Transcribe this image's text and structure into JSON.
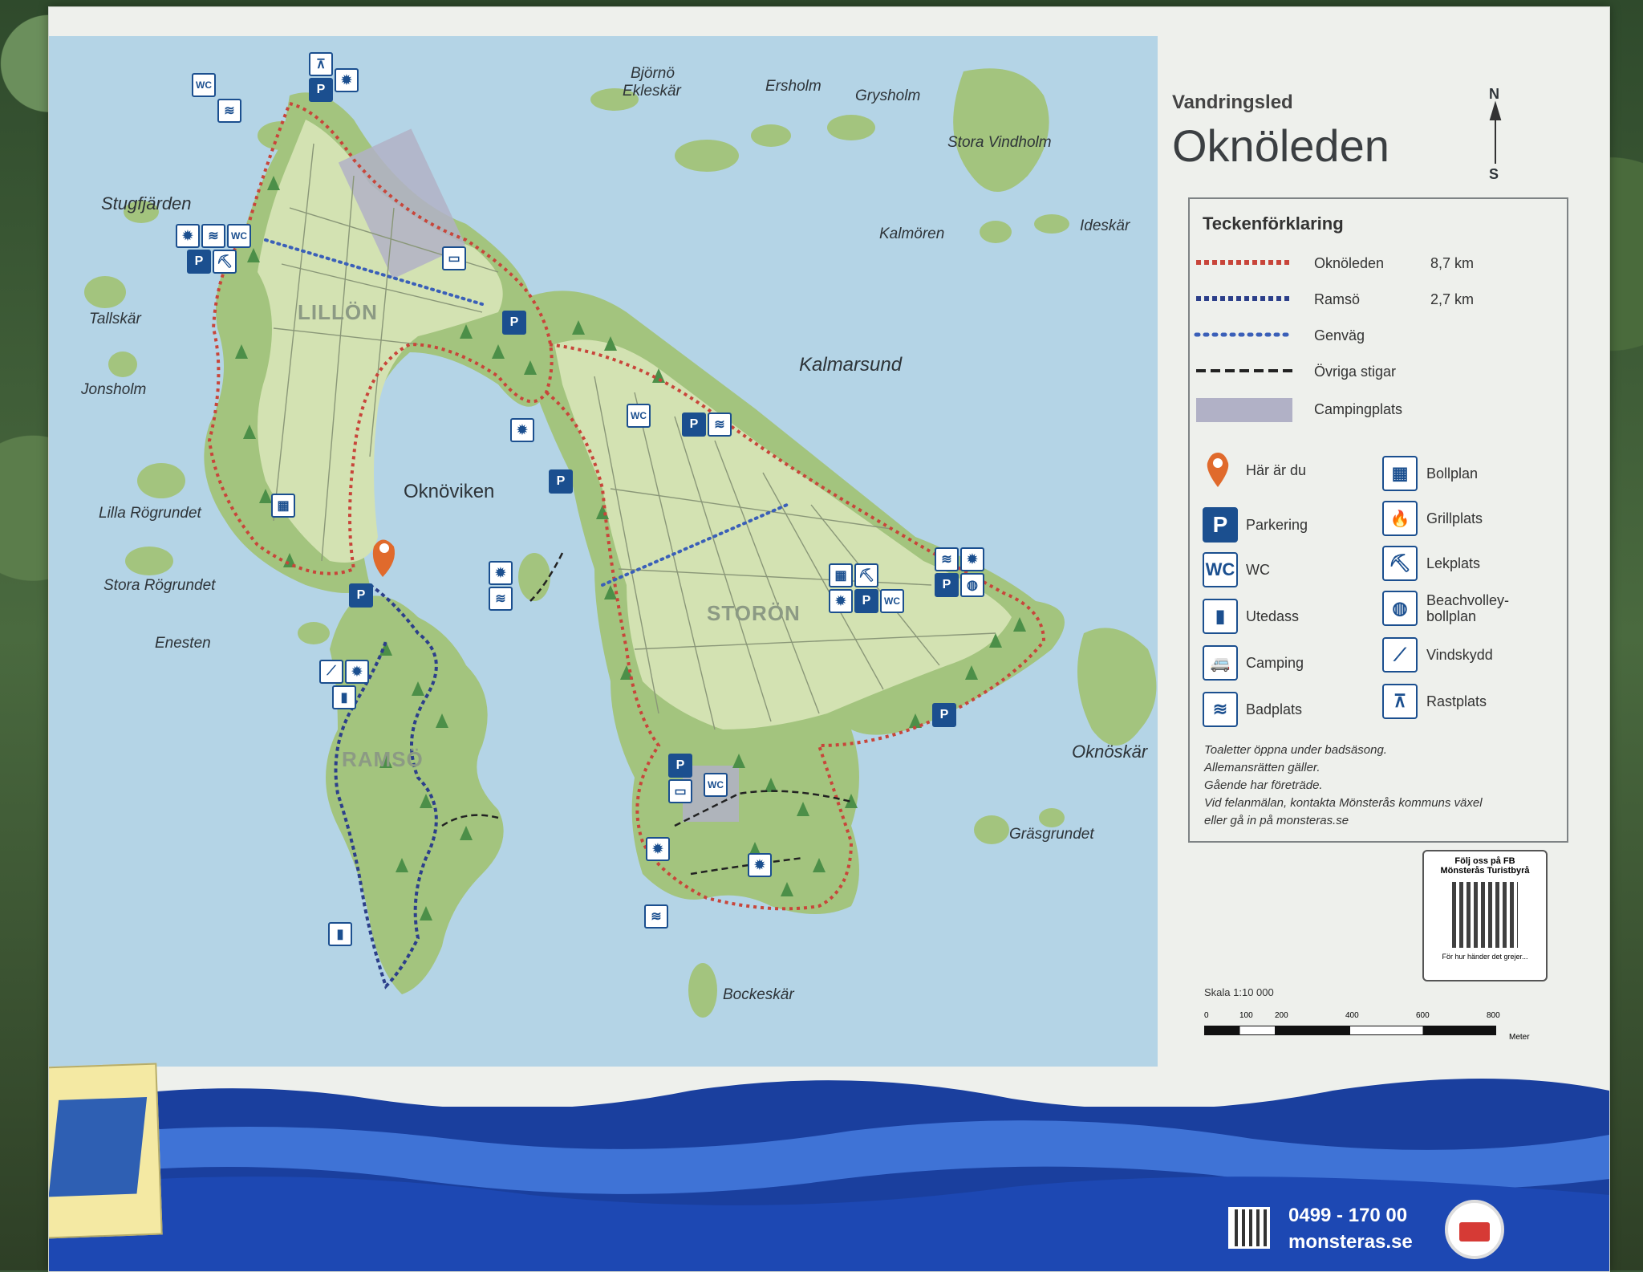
{
  "header": {
    "subtitle": "Vandringsled",
    "title": "Oknöleden",
    "compass_n": "N",
    "compass_s": "S"
  },
  "legend": {
    "title": "Teckenförklaring",
    "lines": [
      {
        "label": "Oknöleden",
        "value": "8,7 km",
        "color": "#c8453a",
        "style": "red-dot"
      },
      {
        "label": "Ramsö",
        "value": "2,7 km",
        "color": "#2c3f8a",
        "style": "blue-dash"
      },
      {
        "label": "Genväg",
        "value": "",
        "color": "#3a5fb8",
        "style": "blue-dot"
      },
      {
        "label": "Övriga stigar",
        "value": "",
        "color": "#222",
        "style": "black-dash"
      },
      {
        "label": "Campingplats",
        "value": "",
        "color": "#a9a9bd",
        "style": "box"
      }
    ],
    "symbols_left": [
      {
        "icon": "location-pin-icon",
        "label": "Här är du"
      },
      {
        "icon": "parking-icon",
        "label": "Parkering",
        "glyph": "P"
      },
      {
        "icon": "wc-icon",
        "label": "WC",
        "glyph": "WC"
      },
      {
        "icon": "outhouse-icon",
        "label": "Utedass",
        "glyph": "▮"
      },
      {
        "icon": "camping-icon",
        "label": "Camping",
        "glyph": "🚐"
      },
      {
        "icon": "swimming-icon",
        "label": "Badplats",
        "glyph": "≋"
      }
    ],
    "symbols_right": [
      {
        "icon": "ball-field-icon",
        "label": "Bollplan",
        "glyph": "▦"
      },
      {
        "icon": "grill-icon",
        "label": "Grillplats",
        "glyph": "🔥"
      },
      {
        "icon": "playground-icon",
        "label": "Lekplats",
        "glyph": "⛏"
      },
      {
        "icon": "beach-volleyball-icon",
        "label": "Beachvolley-\nbollplan",
        "glyph": "◍"
      },
      {
        "icon": "wind-shelter-icon",
        "label": "Vindskydd",
        "glyph": "⟋"
      },
      {
        "icon": "rest-area-icon",
        "label": "Rastplats",
        "glyph": "⊼"
      }
    ],
    "notes": [
      "Toaletter öppna under badsäsong.",
      "Allemansrätten gäller.",
      "Gående har företräde.",
      "Vid felanmälan, kontakta Mönsterås kommuns växel",
      "eller gå in på monsteras.se"
    ]
  },
  "qr": {
    "line1": "Följ oss på FB",
    "line2": "Mönsterås Turistbyrå",
    "footer": "För hur händer det grejer..."
  },
  "scale": {
    "label": "Skala 1:10 000",
    "ticks": [
      "0",
      "100",
      "200",
      "400",
      "600",
      "800"
    ],
    "unit": "Meter"
  },
  "places": {
    "bjorno": "Björnö",
    "ekleskar": "Ekleskär",
    "ersholm": "Ersholm",
    "grysholm": "Grysholm",
    "stora_vindholm": "Stora Vindholm",
    "kalmoren": "Kalmören",
    "ideskar": "Ideskär",
    "stugfjarden": "Stugfjärden",
    "tallskar": "Tallskär",
    "jonsholm": "Jonsholm",
    "lilla_rogrundet": "Lilla Rögrundet",
    "stora_rogrundet": "Stora Rögrundet",
    "enesten": "Enesten",
    "oknoviken": "Oknöviken",
    "kalmarsund": "Kalmarsund",
    "oknoskar": "Oknöskär",
    "grasgrundet": "Gräsgrundet",
    "bockeskar": "Bockeskär",
    "lillon": "LILLÖN",
    "storon": "STORÖN",
    "ramso": "RAMSÖ"
  },
  "footer": {
    "phone": "0499 - 170 00",
    "web": "monsteras.se"
  },
  "colors": {
    "water": "#b4d4e6",
    "land": "#a3c47e",
    "meadow": "#d3e2b2",
    "trail_red": "#c8453a",
    "icon_blue": "#1b4f8f",
    "wave_dark": "#1a3f9e",
    "wave_light": "#3f73d6"
  }
}
